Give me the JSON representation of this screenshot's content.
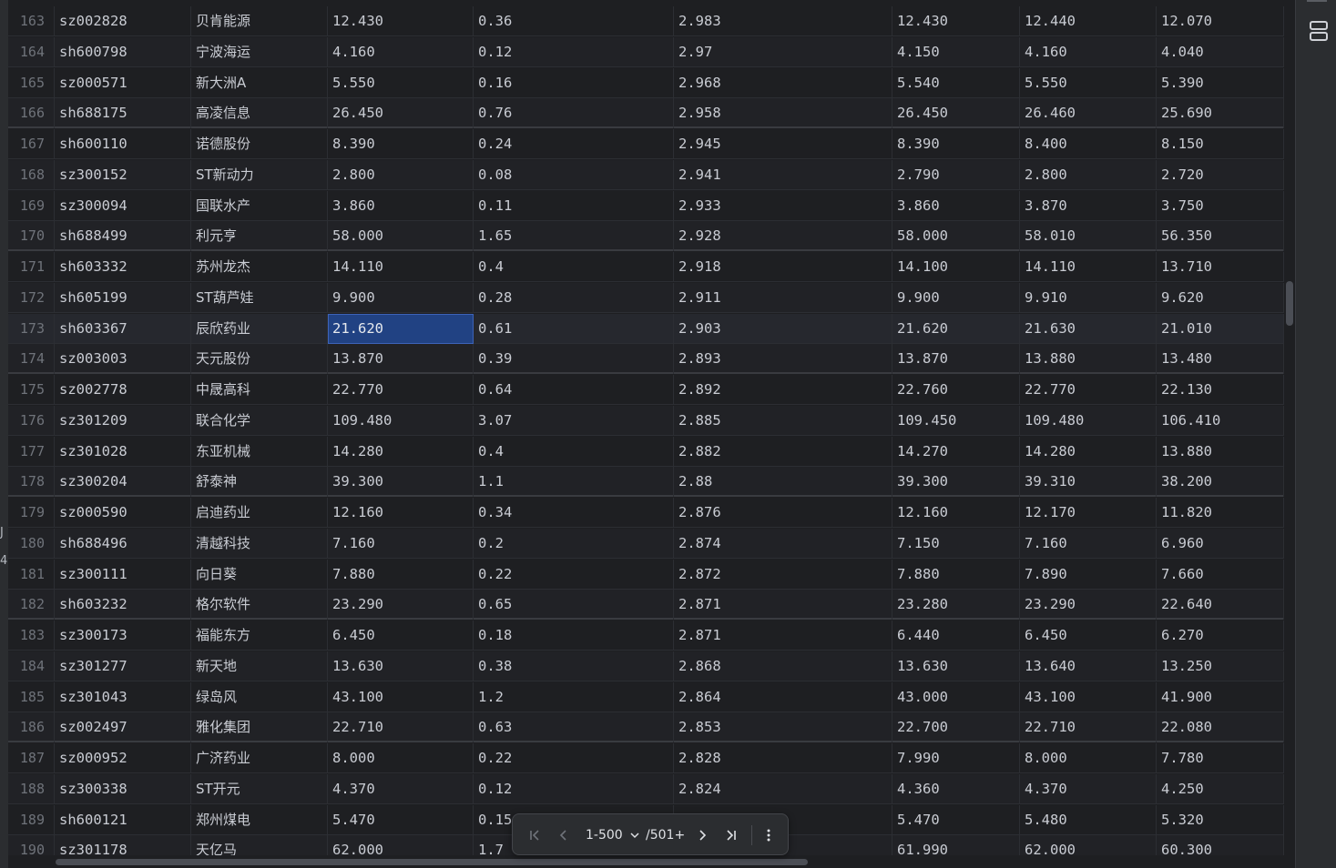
{
  "colors": {
    "background": "#1e1f22",
    "selection": "#214283",
    "text": "#c9ccd3",
    "row_number": "#6f737a"
  },
  "left_gutter": {
    "fragments": [
      "J",
      "4"
    ]
  },
  "table": {
    "selected_row_number": "173",
    "selected_column": "price",
    "rows": [
      {
        "n": "163",
        "code": "sz002828",
        "name": "贝肯能源",
        "price": "12.430",
        "change": "0.36",
        "pct": "2.983",
        "c5": "12.430",
        "c6": "12.440",
        "c7": "12.070"
      },
      {
        "n": "164",
        "code": "sh600798",
        "name": "宁波海运",
        "price": "4.160",
        "change": "0.12",
        "pct": "2.97",
        "c5": "4.150",
        "c6": "4.160",
        "c7": "4.040"
      },
      {
        "n": "165",
        "code": "sz000571",
        "name": "新大洲A",
        "price": "5.550",
        "change": "0.16",
        "pct": "2.968",
        "c5": "5.540",
        "c6": "5.550",
        "c7": "5.390"
      },
      {
        "n": "166",
        "code": "sh688175",
        "name": "高凌信息",
        "price": "26.450",
        "change": "0.76",
        "pct": "2.958",
        "c5": "26.450",
        "c6": "26.460",
        "c7": "25.690"
      },
      {
        "n": "167",
        "code": "sh600110",
        "name": "诺德股份",
        "price": "8.390",
        "change": "0.24",
        "pct": "2.945",
        "c5": "8.390",
        "c6": "8.400",
        "c7": "8.150"
      },
      {
        "n": "168",
        "code": "sz300152",
        "name": "ST新动力",
        "price": "2.800",
        "change": "0.08",
        "pct": "2.941",
        "c5": "2.790",
        "c6": "2.800",
        "c7": "2.720"
      },
      {
        "n": "169",
        "code": "sz300094",
        "name": "国联水产",
        "price": "3.860",
        "change": "0.11",
        "pct": "2.933",
        "c5": "3.860",
        "c6": "3.870",
        "c7": "3.750"
      },
      {
        "n": "170",
        "code": "sh688499",
        "name": "利元亨",
        "price": "58.000",
        "change": "1.65",
        "pct": "2.928",
        "c5": "58.000",
        "c6": "58.010",
        "c7": "56.350"
      },
      {
        "n": "171",
        "code": "sh603332",
        "name": "苏州龙杰",
        "price": "14.110",
        "change": "0.4",
        "pct": "2.918",
        "c5": "14.100",
        "c6": "14.110",
        "c7": "13.710"
      },
      {
        "n": "172",
        "code": "sh605199",
        "name": "ST葫芦娃",
        "price": "9.900",
        "change": "0.28",
        "pct": "2.911",
        "c5": "9.900",
        "c6": "9.910",
        "c7": "9.620"
      },
      {
        "n": "173",
        "code": "sh603367",
        "name": "辰欣药业",
        "price": "21.620",
        "change": "0.61",
        "pct": "2.903",
        "c5": "21.620",
        "c6": "21.630",
        "c7": "21.010"
      },
      {
        "n": "174",
        "code": "sz003003",
        "name": "天元股份",
        "price": "13.870",
        "change": "0.39",
        "pct": "2.893",
        "c5": "13.870",
        "c6": "13.880",
        "c7": "13.480"
      },
      {
        "n": "175",
        "code": "sz002778",
        "name": "中晟高科",
        "price": "22.770",
        "change": "0.64",
        "pct": "2.892",
        "c5": "22.760",
        "c6": "22.770",
        "c7": "22.130"
      },
      {
        "n": "176",
        "code": "sz301209",
        "name": "联合化学",
        "price": "109.480",
        "change": "3.07",
        "pct": "2.885",
        "c5": "109.450",
        "c6": "109.480",
        "c7": "106.410"
      },
      {
        "n": "177",
        "code": "sz301028",
        "name": "东亚机械",
        "price": "14.280",
        "change": "0.4",
        "pct": "2.882",
        "c5": "14.270",
        "c6": "14.280",
        "c7": "13.880"
      },
      {
        "n": "178",
        "code": "sz300204",
        "name": "舒泰神",
        "price": "39.300",
        "change": "1.1",
        "pct": "2.88",
        "c5": "39.300",
        "c6": "39.310",
        "c7": "38.200"
      },
      {
        "n": "179",
        "code": "sz000590",
        "name": "启迪药业",
        "price": "12.160",
        "change": "0.34",
        "pct": "2.876",
        "c5": "12.160",
        "c6": "12.170",
        "c7": "11.820"
      },
      {
        "n": "180",
        "code": "sh688496",
        "name": "清越科技",
        "price": "7.160",
        "change": "0.2",
        "pct": "2.874",
        "c5": "7.150",
        "c6": "7.160",
        "c7": "6.960"
      },
      {
        "n": "181",
        "code": "sz300111",
        "name": "向日葵",
        "price": "7.880",
        "change": "0.22",
        "pct": "2.872",
        "c5": "7.880",
        "c6": "7.890",
        "c7": "7.660"
      },
      {
        "n": "182",
        "code": "sh603232",
        "name": "格尔软件",
        "price": "23.290",
        "change": "0.65",
        "pct": "2.871",
        "c5": "23.280",
        "c6": "23.290",
        "c7": "22.640"
      },
      {
        "n": "183",
        "code": "sz300173",
        "name": "福能东方",
        "price": "6.450",
        "change": "0.18",
        "pct": "2.871",
        "c5": "6.440",
        "c6": "6.450",
        "c7": "6.270"
      },
      {
        "n": "184",
        "code": "sz301277",
        "name": "新天地",
        "price": "13.630",
        "change": "0.38",
        "pct": "2.868",
        "c5": "13.630",
        "c6": "13.640",
        "c7": "13.250"
      },
      {
        "n": "185",
        "code": "sz301043",
        "name": "绿岛风",
        "price": "43.100",
        "change": "1.2",
        "pct": "2.864",
        "c5": "43.000",
        "c6": "43.100",
        "c7": "41.900"
      },
      {
        "n": "186",
        "code": "sz002497",
        "name": "雅化集团",
        "price": "22.710",
        "change": "0.63",
        "pct": "2.853",
        "c5": "22.700",
        "c6": "22.710",
        "c7": "22.080"
      },
      {
        "n": "187",
        "code": "sz000952",
        "name": "广济药业",
        "price": "8.000",
        "change": "0.22",
        "pct": "2.828",
        "c5": "7.990",
        "c6": "8.000",
        "c7": "7.780"
      },
      {
        "n": "188",
        "code": "sz300338",
        "name": "ST开元",
        "price": "4.370",
        "change": "0.12",
        "pct": "2.824",
        "c5": "4.360",
        "c6": "4.370",
        "c7": "4.250"
      },
      {
        "n": "189",
        "code": "sh600121",
        "name": "郑州煤电",
        "price": "5.470",
        "change": "0.15",
        "pct": "",
        "c5": "5.470",
        "c6": "5.480",
        "c7": "5.320"
      },
      {
        "n": "190",
        "code": "sz301178",
        "name": "天亿马",
        "price": "62.000",
        "change": "1.7",
        "pct": "",
        "c5": "61.990",
        "c6": "62.000",
        "c7": "60.300"
      }
    ]
  },
  "pager": {
    "range": "1-500",
    "total": "/501+"
  },
  "icons": {
    "first_page": "first-page-icon",
    "prev_page": "prev-page-icon",
    "next_page": "next-page-icon",
    "last_page": "last-page-icon",
    "more": "more-vertical-icon",
    "layout": "layout-icon",
    "dropdown": "chevron-down-icon"
  }
}
